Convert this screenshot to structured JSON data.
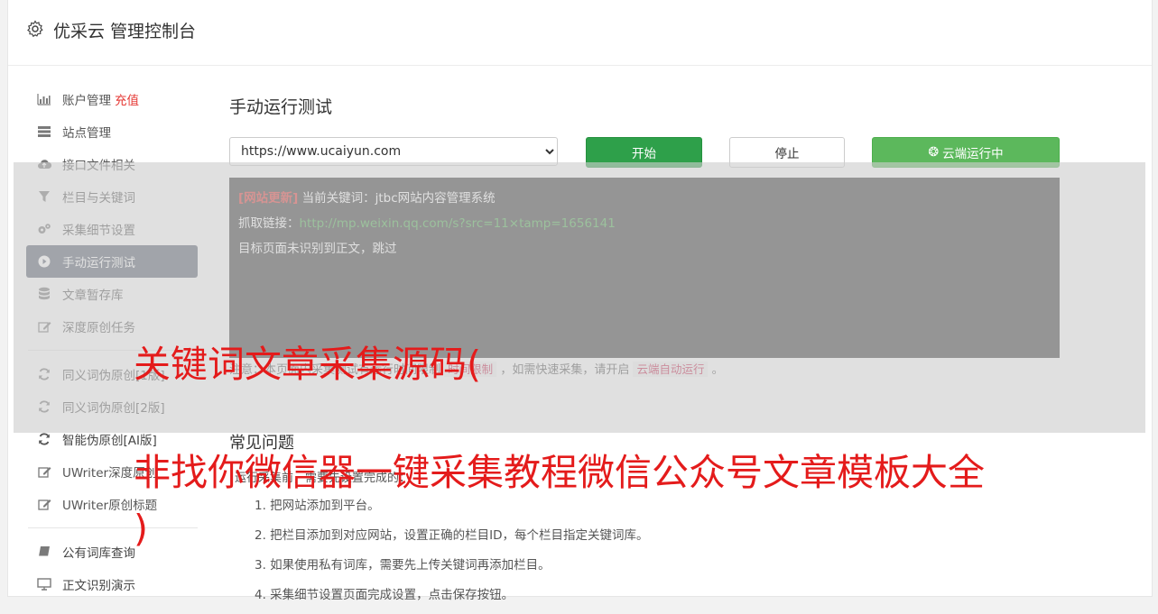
{
  "header": {
    "title": "优采云 管理控制台",
    "icon": "gear-icon"
  },
  "sidebar": {
    "group1": [
      {
        "label": "账户管理",
        "extra": "充值",
        "icon": "bar-chart-icon"
      },
      {
        "label": "站点管理",
        "icon": "server-icon"
      },
      {
        "label": "接口文件相关",
        "icon": "cloud-upload-icon"
      },
      {
        "label": "栏目与关键词",
        "icon": "filter-icon"
      },
      {
        "label": "采集细节设置",
        "icon": "cogs-icon"
      },
      {
        "label": "手动运行测试",
        "icon": "play-circle-icon",
        "active": true
      },
      {
        "label": "文章暂存库",
        "icon": "database-icon"
      },
      {
        "label": "深度原创任务",
        "icon": "edit-icon"
      }
    ],
    "group2": [
      {
        "label": "同义词伪原创[1版]",
        "icon": "refresh-icon"
      },
      {
        "label": "同义词伪原创[2版]",
        "icon": "refresh-icon"
      },
      {
        "label": "智能伪原创[AI版]",
        "icon": "refresh-icon"
      },
      {
        "label": "UWriter深度原创",
        "icon": "edit-icon"
      },
      {
        "label": "UWriter原创标题",
        "icon": "edit-icon"
      }
    ],
    "group3": [
      {
        "label": "公有词库查询",
        "icon": "book-icon"
      },
      {
        "label": "正文识别演示",
        "icon": "monitor-icon"
      }
    ]
  },
  "main": {
    "title": "手动运行测试",
    "url_select": {
      "value": "https://www.ucaiyun.com",
      "options": [
        "https://www.ucaiyun.com"
      ]
    },
    "start_label": "开始",
    "stop_label": "停止",
    "cloud_label": "云端运行中",
    "console": {
      "tag": "[网站更新]",
      "keyword_prefix": "当前关键词：",
      "keyword": "jtbc网站内容管理系统",
      "fetch_prefix": "抓取链接：",
      "fetch_url": "http://mp.weixin.qq.com/s?src=11×tamp=1656141",
      "message": "目标页面未识别到正文，跳过"
    },
    "note": {
      "prefix": "注意：本页面内采集测试有运行时间限制",
      "highlight1": "时间限制",
      "middle": "，如需快速采集，请开启",
      "highlight2": "云端自动运行",
      "suffix": "。"
    },
    "faq": {
      "title": "常见问题",
      "subtitle": "运行采集前，需要先设置完成的：",
      "items": [
        "1. 把网站添加到平台。",
        "2. 把栏目添加到对应网站，设置正确的栏目ID，每个栏目指定关键词库。",
        "3. 如果使用私有词库，需要先上传关键词再添加栏目。",
        "4. 采集细节设置页面完成设置，点击保存按钮。"
      ]
    }
  },
  "overlay_text": {
    "line1": "关键词文章采集源码(",
    "line2": "非找你微信器一键采集教程微信公众号文章模板大全",
    "line3": ")"
  },
  "colors": {
    "accent_red": "#e41b1b",
    "start_green": "#2ea04a",
    "cloud_green": "#5cb85c",
    "active_nav": "#5a6372",
    "console_bg": "#3a3a3a"
  }
}
